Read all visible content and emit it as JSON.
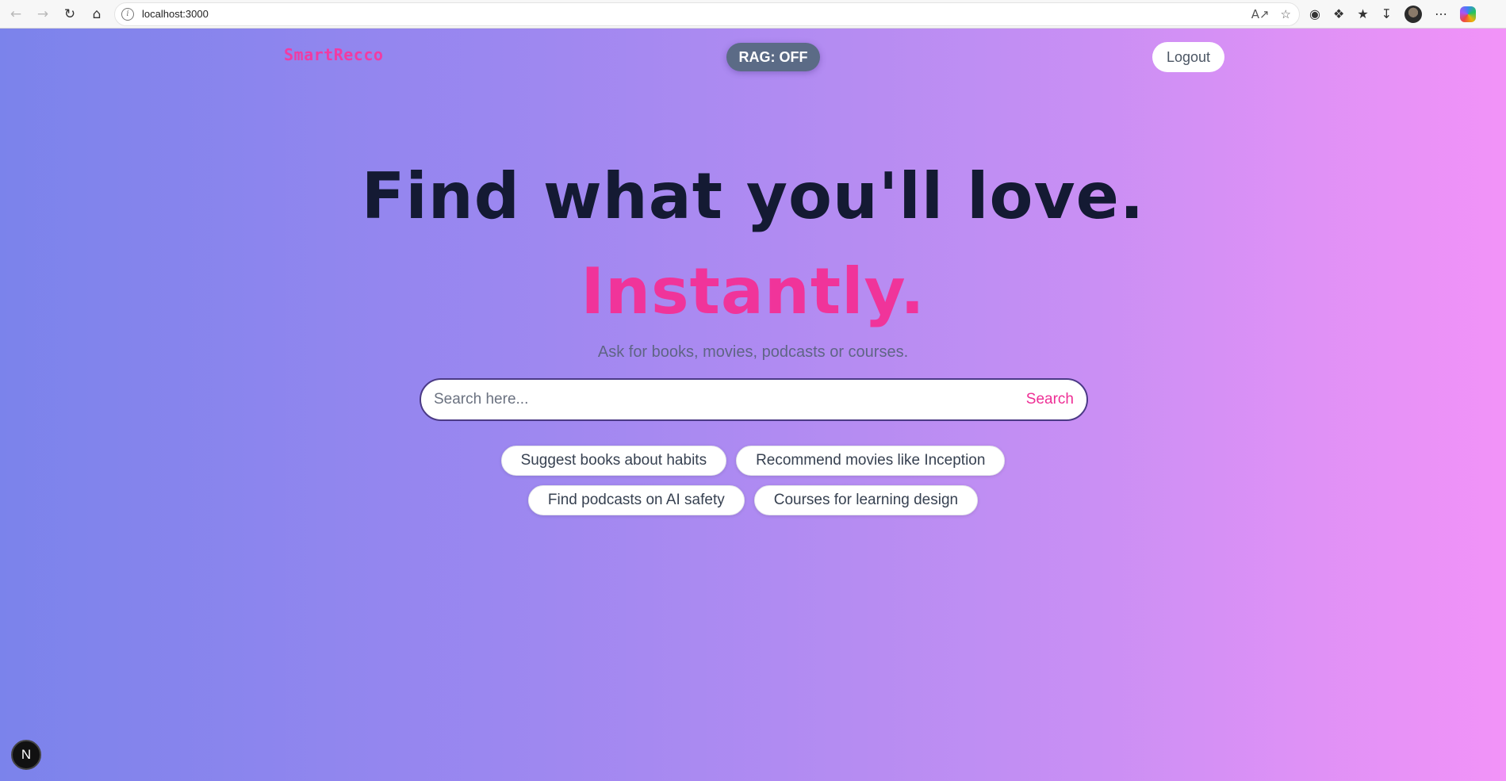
{
  "browser": {
    "url": "localhost:3000",
    "icons": [
      "back-icon",
      "forward-icon",
      "reload-icon",
      "home-icon",
      "site-info-icon",
      "read-aloud-icon",
      "favorite-star-icon",
      "adblock-icon",
      "extensions-icon",
      "favorites-icon",
      "downloads-icon",
      "profile-avatar",
      "more-icon",
      "copilot-icon"
    ]
  },
  "header": {
    "logo": "SmartRecco",
    "rag_toggle": "RAG: OFF",
    "logout": "Logout"
  },
  "hero": {
    "title": "Find what you'll love.",
    "accent": "Instantly.",
    "subtitle": "Ask for books, movies, podcasts or courses."
  },
  "search": {
    "placeholder": "Search here...",
    "button": "Search"
  },
  "suggestions": [
    "Suggest books about habits",
    "Recommend movies like Inception",
    "Find podcasts on AI safety",
    "Courses for learning design"
  ],
  "dev_badge": "N",
  "colors": {
    "accent": "#f0349a",
    "logo": "#f13ba3",
    "heading": "#141a33",
    "rag_bg": "#5b6b86",
    "gradient_start": "#7b83eb",
    "gradient_end": "#f293f8"
  }
}
